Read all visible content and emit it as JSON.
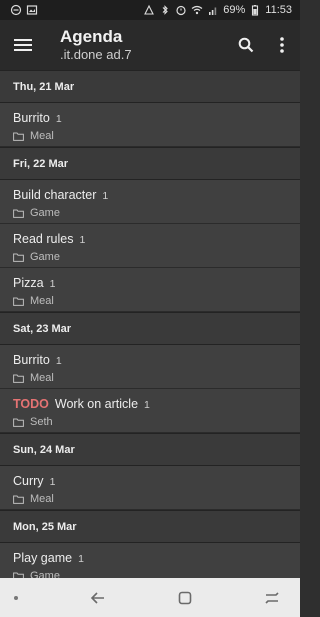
{
  "status": {
    "battery": "69%",
    "time": "11:53"
  },
  "appbar": {
    "title": "Agenda",
    "subtitle": ".it.done ad.7",
    "menu_icon": "menu-icon",
    "search_icon": "search-icon",
    "more_icon": "more-vert-icon"
  },
  "days": [
    {
      "date": "Thu, 21 Mar",
      "items": [
        {
          "title": "Burrito",
          "count": "1",
          "tag": "Meal"
        }
      ]
    },
    {
      "date": "Fri, 22 Mar",
      "items": [
        {
          "title": "Build character",
          "count": "1",
          "tag": "Game"
        },
        {
          "title": "Read rules",
          "count": "1",
          "tag": "Game"
        },
        {
          "title": "Pizza",
          "count": "1",
          "tag": "Meal"
        }
      ]
    },
    {
      "date": "Sat, 23 Mar",
      "items": [
        {
          "title": "Burrito",
          "count": "1",
          "tag": "Meal"
        },
        {
          "todo": "TODO",
          "title": "Work on article",
          "count": "1",
          "tag": "Seth"
        }
      ]
    },
    {
      "date": "Sun, 24 Mar",
      "items": [
        {
          "title": "Curry",
          "count": "1",
          "tag": "Meal"
        }
      ]
    },
    {
      "date": "Mon, 25 Mar",
      "items": [
        {
          "title": "Play game",
          "count": "1",
          "tag": "Game"
        }
      ]
    }
  ],
  "colors": {
    "todo": "#e57373",
    "item_bg": "#404040",
    "header_bg": "#3a3a3a"
  }
}
